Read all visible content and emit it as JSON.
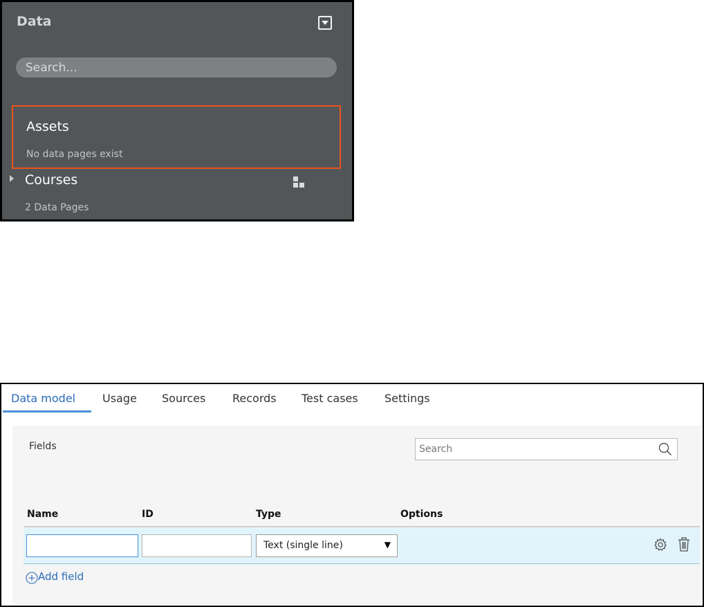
{
  "data_panel": {
    "title": "Data",
    "search_placeholder": "Search...",
    "items": [
      {
        "name": "Assets",
        "subtitle": "No data pages exist"
      },
      {
        "name": "Courses",
        "subtitle": "2 Data Pages"
      }
    ],
    "highlight_color": "#e8541b"
  },
  "model_panel": {
    "tabs": [
      {
        "label": "Data model",
        "active": true
      },
      {
        "label": "Usage"
      },
      {
        "label": "Sources"
      },
      {
        "label": "Records"
      },
      {
        "label": "Test cases"
      },
      {
        "label": "Settings"
      }
    ],
    "fields_label": "Fields",
    "search_placeholder": "Search",
    "columns": [
      "Name",
      "ID",
      "Type",
      "Options"
    ],
    "row": {
      "name_value": "",
      "id_value": "",
      "type_value": "Text (single line)"
    },
    "add_field_label": "Add field",
    "accent_color": "#2a6bb8"
  }
}
